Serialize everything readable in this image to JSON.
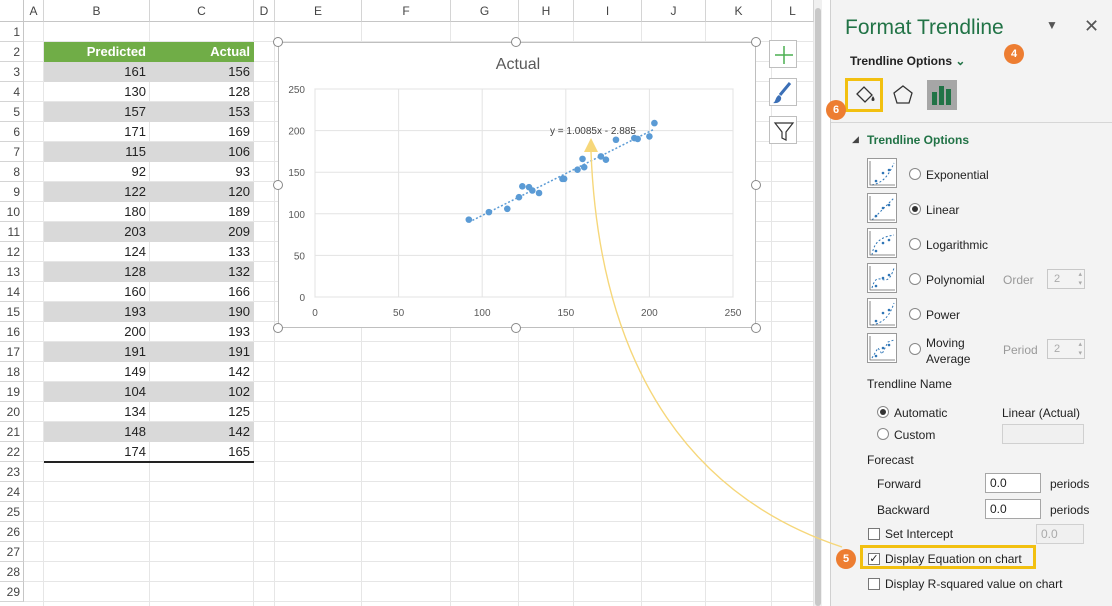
{
  "sheet": {
    "columns": [
      "A",
      "B",
      "C",
      "D",
      "E",
      "F",
      "G",
      "H",
      "I",
      "J",
      "K",
      "L"
    ],
    "rows": [
      "1",
      "2",
      "3",
      "4",
      "5",
      "6",
      "7",
      "8",
      "9",
      "10",
      "11",
      "12",
      "13",
      "14",
      "15",
      "16",
      "17",
      "18",
      "19",
      "20",
      "21",
      "22",
      "23",
      "24",
      "25",
      "26",
      "27",
      "28",
      "29"
    ],
    "table": {
      "headers": [
        "Predicted",
        "Actual"
      ],
      "rows": [
        [
          161,
          156
        ],
        [
          130,
          128
        ],
        [
          157,
          153
        ],
        [
          171,
          169
        ],
        [
          115,
          106
        ],
        [
          92,
          93
        ],
        [
          122,
          120
        ],
        [
          180,
          189
        ],
        [
          203,
          209
        ],
        [
          124,
          133
        ],
        [
          128,
          132
        ],
        [
          160,
          166
        ],
        [
          193,
          190
        ],
        [
          200,
          193
        ],
        [
          191,
          191
        ],
        [
          149,
          142
        ],
        [
          104,
          102
        ],
        [
          134,
          125
        ],
        [
          148,
          142
        ],
        [
          174,
          165
        ]
      ]
    }
  },
  "chart_data": {
    "type": "scatter",
    "title": "Actual",
    "xlim": [
      0,
      250
    ],
    "ylim": [
      0,
      250
    ],
    "xticks": [
      0,
      50,
      100,
      150,
      200,
      250
    ],
    "yticks": [
      0,
      50,
      100,
      150,
      200,
      250
    ],
    "grid": true,
    "series": [
      {
        "x": [
          161,
          130,
          157,
          171,
          115,
          92,
          122,
          180,
          203,
          124,
          128,
          160,
          193,
          200,
          191,
          149,
          104,
          134,
          148,
          174
        ],
        "y": [
          156,
          128,
          153,
          169,
          106,
          93,
          120,
          189,
          209,
          133,
          132,
          166,
          190,
          193,
          191,
          142,
          102,
          125,
          142,
          165
        ],
        "color": "#5b9bd5"
      }
    ],
    "trendline": {
      "type": "linear",
      "slope": 1.0085,
      "intercept": -2.885,
      "x_range": [
        92,
        203
      ],
      "color": "#5b9bd5"
    },
    "equation_label": "y = 1.0085x - 2.885"
  },
  "chart_buttons": {
    "add_icon": "plus-icon",
    "style_icon": "brush-icon",
    "filter_icon": "funnel-icon"
  },
  "pane": {
    "title": "Format Trendline",
    "options_dropdown": "Trendline Options",
    "section_title": "Trendline Options",
    "types": [
      {
        "label": "Exponential",
        "selected": false
      },
      {
        "label": "Linear",
        "selected": true
      },
      {
        "label": "Logarithmic",
        "selected": false
      },
      {
        "label": "Polynomial",
        "selected": false,
        "extra_label": "Order",
        "extra_value": "2"
      },
      {
        "label": "Power",
        "selected": false
      },
      {
        "label": "Moving",
        "label2": "Average",
        "selected": false,
        "extra_label": "Period",
        "extra_value": "2"
      }
    ],
    "name_section": "Trendline Name",
    "automatic_label": "Automatic",
    "automatic_value": "Linear (Actual)",
    "custom_label": "Custom",
    "forecast_label": "Forecast",
    "forward_label": "Forward",
    "forward_value": "0.0",
    "backward_label": "Backward",
    "backward_value": "0.0",
    "periods_label": "periods",
    "set_intercept_label": "Set Intercept",
    "set_intercept_value": "0.0",
    "display_equation_label": "Display Equation on chart",
    "display_equation_checked": true,
    "display_r2_label": "Display R-squared value on chart",
    "display_r2_checked": false
  },
  "badges": {
    "b4": "4",
    "b5": "5",
    "b6": "6"
  },
  "colors": {
    "accent_green": "#217346",
    "table_header": "#70ad47",
    "highlight": "#f2c010",
    "badge": "#ed7d31",
    "marker": "#5b9bd5"
  }
}
